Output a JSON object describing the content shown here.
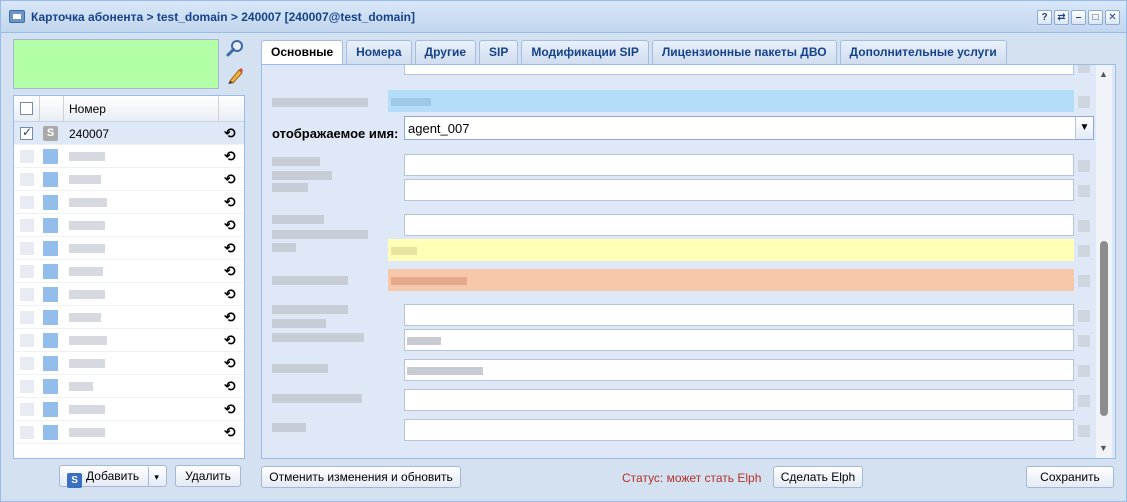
{
  "window": {
    "title": "Карточка абонента > test_domain > 240007 [240007@test_domain]",
    "buttons": [
      "?",
      "⇄",
      "–",
      "□",
      "✕"
    ]
  },
  "left": {
    "grid": {
      "header": "Номер",
      "rows": [
        {
          "number": "240007",
          "checked": true,
          "icon": "S"
        }
      ],
      "blurred_rows": 13
    },
    "add_button": "Добавить",
    "delete_button": "Удалить"
  },
  "tabs": [
    {
      "label": "Основные",
      "active": true
    },
    {
      "label": "Номера"
    },
    {
      "label": "Другие"
    },
    {
      "label": "SIP"
    },
    {
      "label": "Модификации SIP"
    },
    {
      "label": "Лицензионные пакеты ДВО"
    },
    {
      "label": "Дополнительные услуги"
    }
  ],
  "form": {
    "display_name_label": "отображаемое имя:",
    "display_name_value": "agent_007"
  },
  "footer": {
    "cancel_button": "Отменить изменения и обновить",
    "status": "Статус: может стать Elph",
    "make_elph_button": "Сделать Elph",
    "save_button": "Сохранить"
  },
  "colors": {
    "green_box": "#b3ffa8",
    "blue_field": "#b3ddf9",
    "yellow_field": "#ffffb8",
    "orange_field": "#f7c7a9",
    "status_text": "#b2322a"
  }
}
